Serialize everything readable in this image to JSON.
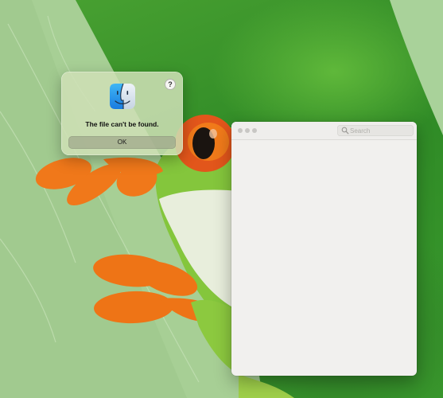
{
  "alert": {
    "help_label": "?",
    "message": "The file can't be found.",
    "ok_label": "OK",
    "icon": "finder-icon"
  },
  "window": {
    "search": {
      "placeholder": "Search",
      "value": ""
    },
    "traffic_lights": [
      "close",
      "minimize",
      "zoom"
    ]
  },
  "wallpaper": {
    "subject": "frog-on-leaf",
    "colors": {
      "leaf": "#a8cf94",
      "frog_green": "#7cc23a",
      "orange": "#f07a16",
      "eye_red": "#e0501a"
    }
  }
}
